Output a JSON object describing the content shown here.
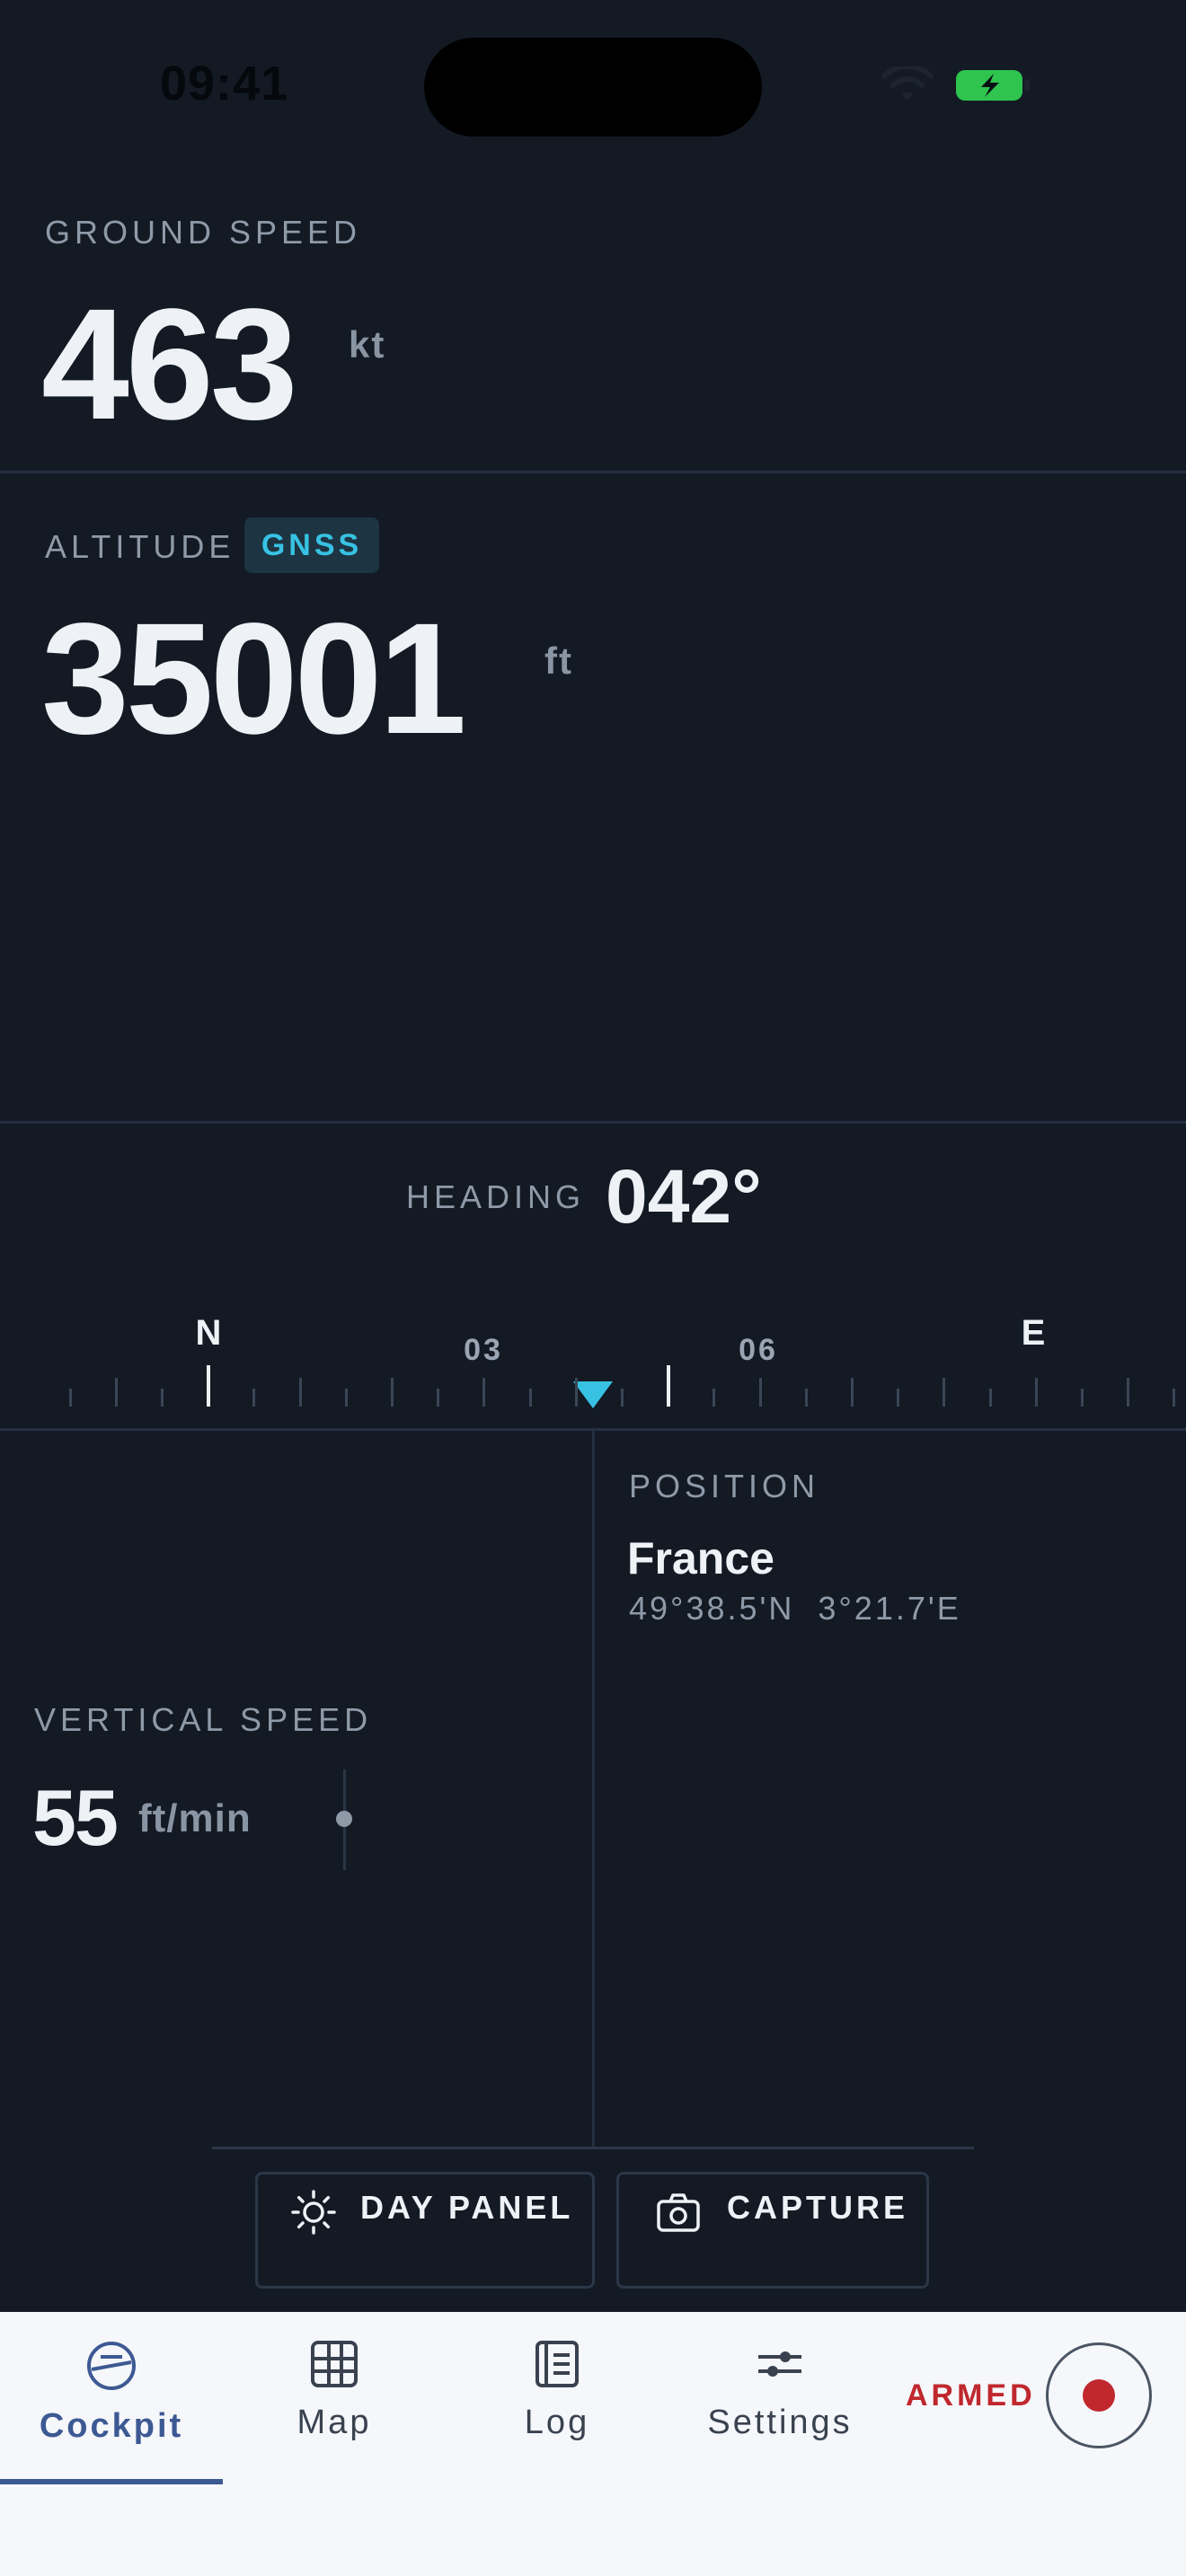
{
  "status": {
    "time": "09:41"
  },
  "ground_speed": {
    "label": "GROUND SPEED",
    "value": "463",
    "unit": "kt"
  },
  "altitude": {
    "label": "ALTITUDE",
    "source": "GNSS",
    "value": "35001",
    "unit": "ft"
  },
  "heading": {
    "label": "HEADING",
    "value": "042°",
    "tape": {
      "cardinal_n": "N",
      "cardinal_e": "E",
      "mark_03": "03",
      "mark_06": "06"
    }
  },
  "vertical_speed": {
    "label": "VERTICAL SPEED",
    "value": "55",
    "unit": "ft/min"
  },
  "position": {
    "label": "POSITION",
    "country": "France",
    "coordinates": "49°38.5'N  3°21.7'E"
  },
  "actions": {
    "day_panel": "DAY PANEL",
    "capture": "CAPTURE"
  },
  "nav": {
    "items": [
      {
        "label": "Cockpit",
        "icon": "cockpit-icon",
        "active": true
      },
      {
        "label": "Map",
        "icon": "map-icon",
        "active": false
      },
      {
        "label": "Log",
        "icon": "log-icon",
        "active": false
      },
      {
        "label": "Settings",
        "icon": "settings-icon",
        "active": false
      }
    ],
    "armed_label": "ARMED"
  },
  "colors": {
    "background": "#131a24",
    "accent_cyan": "#37c2e3",
    "nav_active": "#3d5993",
    "armed_red": "#c0282e",
    "battery_green": "#2ec44e"
  }
}
